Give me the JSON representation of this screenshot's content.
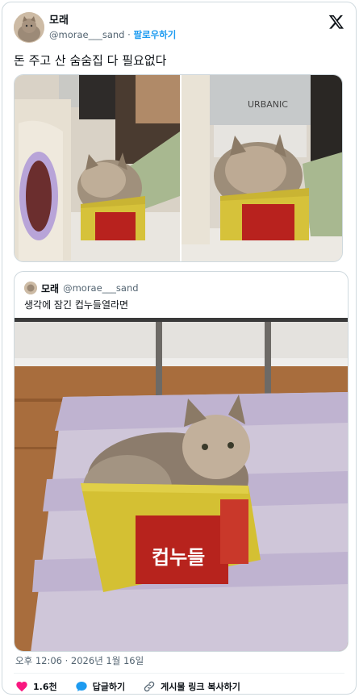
{
  "tweet": {
    "author": {
      "display_name": "모래",
      "handle": "@morae___sand"
    },
    "separator": "·",
    "follow_label": "팔로우하기",
    "text": "돈 주고 산 숨숨집 다 필요없다",
    "timestamp": "오후 12:06 · 2026년 1월 16일"
  },
  "quote": {
    "author": {
      "display_name": "모래",
      "handle": "@morae___sand"
    },
    "text": "생각에 잠긴 컵누들열라면"
  },
  "actions": {
    "likes": "1.6천",
    "reply_label": "답글하기",
    "copy_link_label": "게시물 링크 복사하기"
  },
  "icons": [
    "x-logo-icon",
    "heart-icon",
    "reply-bubble-icon",
    "link-icon"
  ],
  "colors": {
    "accent": "#1d9bf0",
    "like": "#f91880",
    "muted": "#536471",
    "border": "#cfd9de"
  }
}
